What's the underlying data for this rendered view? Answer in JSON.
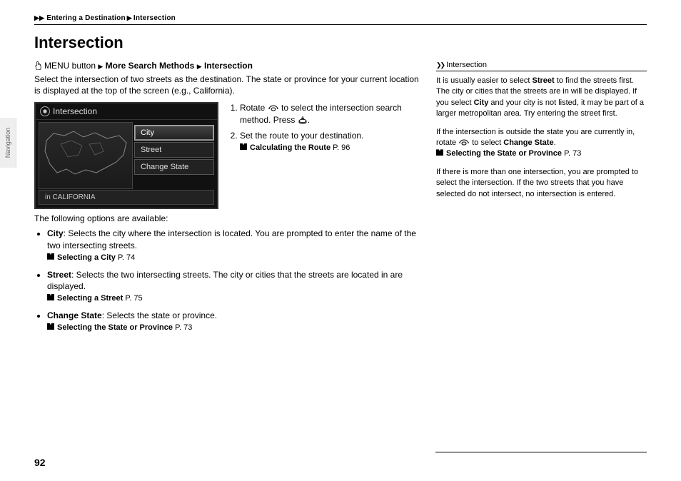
{
  "breadcrumb": {
    "a": "Entering a Destination",
    "b": "Intersection"
  },
  "title": "Intersection",
  "sideTab": "Navigation",
  "pageNumber": "92",
  "menuPath": {
    "prefix": "MENU button",
    "mid": "More Search Methods",
    "end": "Intersection"
  },
  "intro": "Select the intersection of two streets as the destination. The state or province for your current location is displayed at the top of the screen (e.g., California).",
  "screen": {
    "title": "Intersection",
    "items": [
      "City",
      "Street",
      "Change State"
    ],
    "stateBar": "in CALIFORNIA"
  },
  "steps": {
    "s1a": "Rotate ",
    "s1b": " to select the intersection search method. Press ",
    "s1c": ".",
    "s2": "Set the route to your destination.",
    "ref2": "Calculating the Route",
    "ref2p": "P. 96"
  },
  "afterImg": "The following options are available:",
  "options": {
    "o1": {
      "label": "City",
      "text": ": Selects the city where the intersection is located. You are prompted to enter the name of the two intersecting streets.",
      "ref": "Selecting a City",
      "refp": "P. 74"
    },
    "o2": {
      "label": "Street",
      "text": ": Selects the two intersecting streets. The city or cities that the streets are located in are displayed.",
      "ref": "Selecting a Street",
      "refp": "P. 75"
    },
    "o3": {
      "label": "Change State",
      "text": ": Selects the state or province.",
      "ref": "Selecting the State or Province",
      "refp": "P. 73"
    }
  },
  "sidebar": {
    "title": "Intersection",
    "p1a": "It is usually easier to select ",
    "p1b": "Street",
    "p1c": " to find the streets first. The city or cities that the streets are in will be displayed. If you select ",
    "p1d": "City",
    "p1e": " and your city is not listed, it may be part of a larger metropolitan area. Try entering the street first.",
    "p2a": "If the intersection is outside the state you are currently in, rotate ",
    "p2b": " to select ",
    "p2c": "Change State",
    "p2d": ".",
    "p2ref": "Selecting the State or Province",
    "p2refp": "P. 73",
    "p3": "If there is more than one intersection, you are prompted to select the intersection. If the two streets that you have selected do not intersect, no intersection is entered."
  }
}
